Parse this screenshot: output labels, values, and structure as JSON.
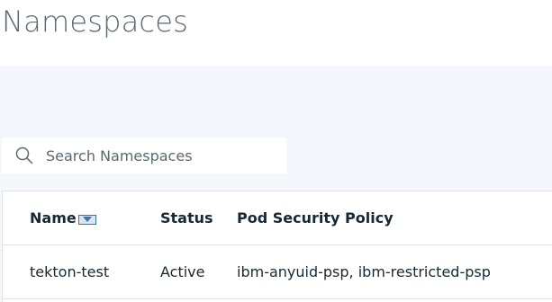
{
  "page": {
    "title": "Namespaces"
  },
  "search": {
    "placeholder": "Search Namespaces",
    "value": ""
  },
  "table": {
    "columns": [
      {
        "label": "Name",
        "sorted": "descending"
      },
      {
        "label": "Status"
      },
      {
        "label": "Pod Security Policy"
      }
    ],
    "rows": [
      {
        "name": "tekton-test",
        "status": "Active",
        "pod_security_policy": "ibm-anyuid-psp, ibm-restricted-psp"
      }
    ]
  },
  "icons": {
    "search": "search-icon",
    "sort": "sort-descending-icon"
  },
  "colors": {
    "background_band": "#f4f7fb",
    "title": "#5a6872",
    "text": "#152935",
    "accent": "#3d70b2",
    "border": "#dfe3e6"
  }
}
